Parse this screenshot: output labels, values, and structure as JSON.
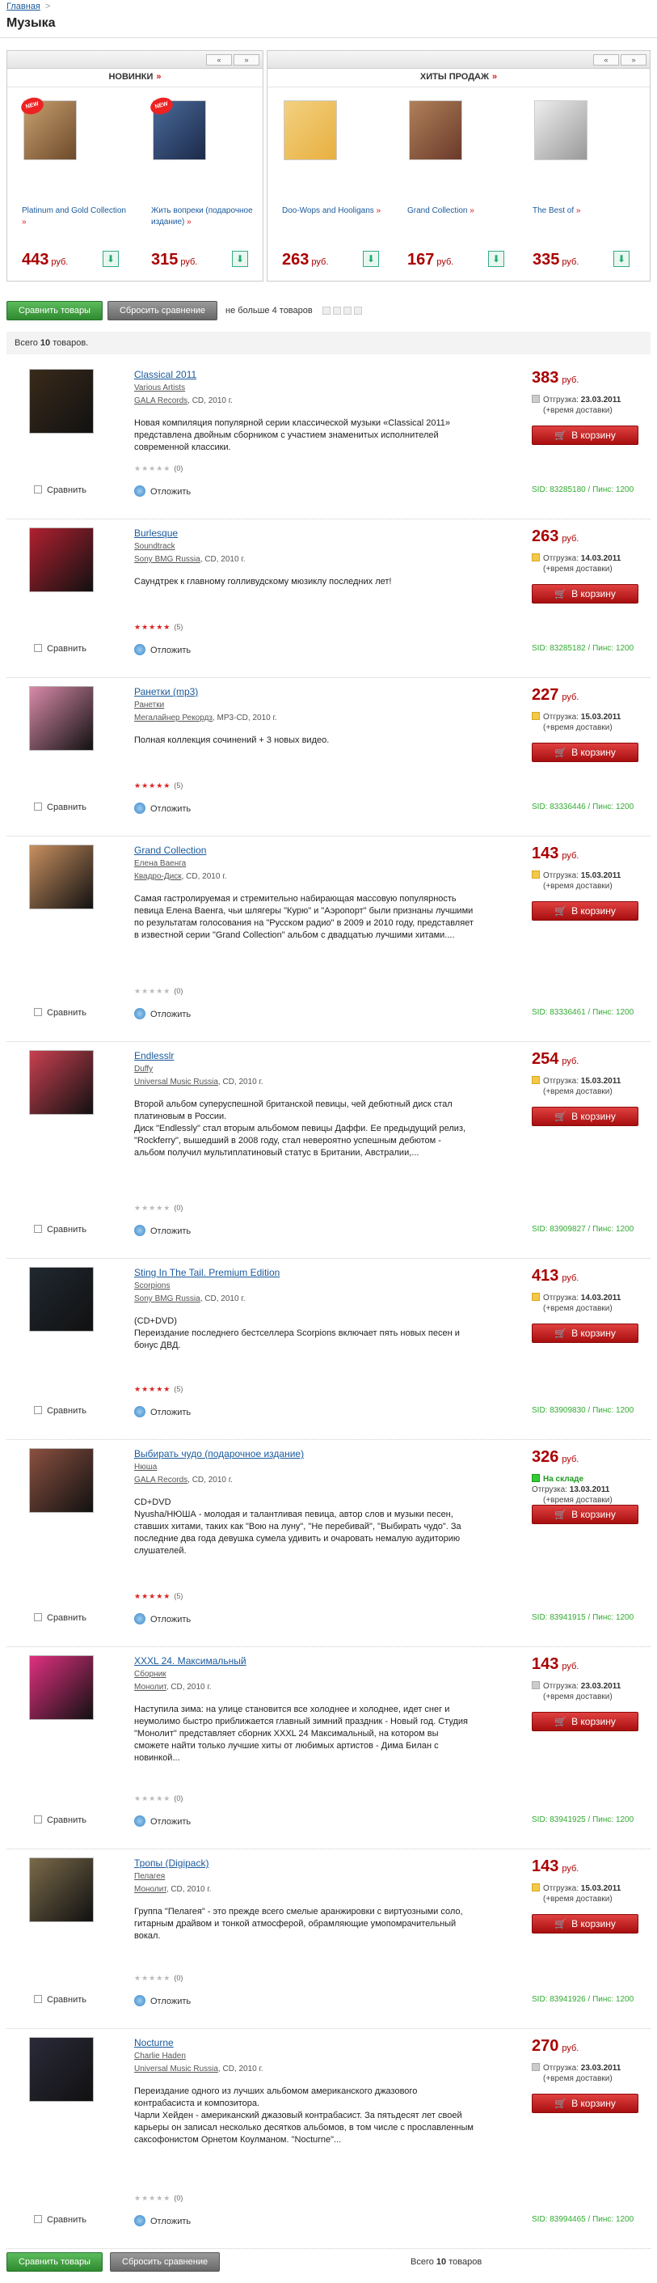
{
  "breadcrumb": {
    "home": "Главная",
    "sep": ">"
  },
  "title": "Музыка",
  "panels": {
    "new": {
      "title": "НОВИНКИ",
      "arrow": "»",
      "nav_prev": "«",
      "nav_next": "»",
      "badge": "NEW",
      "items": [
        {
          "name": "Platinum and Gold Collection",
          "more": "»",
          "price": "443",
          "rub": "руб.",
          "color": "#6d4a2a"
        },
        {
          "name": "Жить вопреки (подарочное издание)",
          "more": "»",
          "price": "315",
          "rub": "руб.",
          "color": "#1c2a4a"
        }
      ]
    },
    "hits": {
      "title": "ХИТЫ ПРОДАЖ",
      "arrow": "»",
      "nav_prev": "«",
      "nav_next": "»",
      "items": [
        {
          "name": "Doo-Wops and Hooligans",
          "more": "»",
          "price": "263",
          "rub": "руб.",
          "color": "#e8b040"
        },
        {
          "name": "Grand Collection",
          "more": "»",
          "price": "167",
          "rub": "руб.",
          "color": "#6a3a2a"
        },
        {
          "name": "The Best of",
          "more": "»",
          "price": "335",
          "rub": "руб.",
          "color": "#cfcfcf"
        }
      ]
    }
  },
  "compare": {
    "btn": "Сравнить товары",
    "reset": "Сбросить сравнение",
    "note": "не больше 4 товаров"
  },
  "total": {
    "prefix": "Всего",
    "count": "10",
    "suffix": "товаров."
  },
  "labels": {
    "compare": "Сравнить",
    "later": "Отложить",
    "cart": "В корзину",
    "rub": "руб.",
    "ship": "Отгрузка:",
    "delivery": "(+время доставки)",
    "instock": "На складе",
    "sid_prefix": "SID:",
    "pins_prefix": "Пинс:"
  },
  "items": [
    {
      "title": "Classical 2011",
      "artist": "Various Artists",
      "label": "GALA Records",
      "meta": ", CD, 2010 г.",
      "desc": "Новая компиляция популярной серии классической музыки «Classical 2011» представлена двойным сборником с участием знаменитых исполнителей современной классики.",
      "stars": "★★★★★",
      "rating": "(0)",
      "price": "383",
      "date": "23.03.2011",
      "sid": "83285180",
      "pins": "1200",
      "color": "#3a2a1a",
      "shipcolor": "grey"
    },
    {
      "title": "Burlesque",
      "artist": "Soundtrack",
      "label": "Sony BMG Russia",
      "meta": ", CD, 2010 г.",
      "desc": "Саундтрек к главному голливудскому мюзиклу последних лет!",
      "stars": "★★★★★",
      "rating": "(5)",
      "price": "263",
      "date": "14.03.2011",
      "sid": "83285182",
      "pins": "1200",
      "color": "#b02030",
      "shipcolor": ""
    },
    {
      "title": "Ранетки (mp3)",
      "artist": "Ранетки",
      "label": "Мегалайнер Рекордз",
      "meta": ", MP3-CD, 2010 г.",
      "desc": "Полная коллекция сочинений + 3 новых видео.",
      "stars": "★★★★★",
      "rating": "(5)",
      "price": "227",
      "date": "15.03.2011",
      "sid": "83336446",
      "pins": "1200",
      "color": "#d88aa8",
      "shipcolor": ""
    },
    {
      "title": "Grand Collection",
      "artist": "Елена Ваенга",
      "label": "Квадро-Диск",
      "meta": ", CD, 2010 г.",
      "desc": "Самая гастролируемая и стремительно набирающая массовую популярность певица Елена Ваенга, чьи шлягеры \"Курю\" и \"Аэропорт\" были признаны лучшими по результатам голосования на \"Русском радио\" в 2009 и 2010 году, представляет в известной серии \"Grand Collection\" альбом с двадцатью лучшими хитами....",
      "stars": "★★★★★",
      "rating": "(0)",
      "price": "143",
      "date": "15.03.2011",
      "sid": "83336461",
      "pins": "1200",
      "color": "#c89060",
      "shipcolor": ""
    },
    {
      "title": "Endlesslr",
      "artist": "Duffy",
      "label": "Universal Music Russia",
      "meta": ", CD, 2010 г.",
      "desc": "Второй альбом суперуспешной британской певицы, чей дебютный диск стал платиновым в России.\nДиск \"Endlessly\" стал вторым альбомом певицы Даффи. Ее предыдущий релиз, \"Rockferry\", вышедший в 2008 году, стал невероятно успешным дебютом - альбом получил мультиплатиновый статус в Британии, Австралии,...",
      "stars": "★★★★★",
      "rating": "(0)",
      "price": "254",
      "date": "15.03.2011",
      "sid": "83909827",
      "pins": "1200",
      "color": "#c84050",
      "shipcolor": ""
    },
    {
      "title": "Sting In The Tail. Premium Edition",
      "artist": "Scorpions",
      "label": "Sony BMG Russia",
      "meta": ", CD, 2010 г.",
      "desc": "(CD+DVD)\nПереиздание последнего бестселлера Scorpions включает пять новых песен и бонус ДВД.",
      "stars": "★★★★★",
      "rating": "(5)",
      "price": "413",
      "date": "14.03.2011",
      "sid": "83909830",
      "pins": "1200",
      "color": "#202830",
      "shipcolor": ""
    },
    {
      "title": "Выбирать чудо (подарочное издание)",
      "artist": "Нюша",
      "label": "GALA Records",
      "meta": ", CD, 2010 г.",
      "desc": "CD+DVD\nNyusha/НЮША - молодая и талантливая певица, автор слов и музыки песен, ставших хитами, таких как \"Вою на луну\", \"Не перебивай\", \"Выбирать чудо\". За последние два года девушка сумела удивить и очаровать немалую аудиторию слушателей.",
      "stars": "★★★★★",
      "rating": "(5)",
      "price": "326",
      "date": "13.03.2011",
      "sid": "83941915",
      "pins": "1200",
      "color": "#8a5040",
      "shipcolor": "green",
      "instock": true
    },
    {
      "title": "XXXL 24. Максимальный",
      "artist": "Сборник",
      "label": "Монолит",
      "meta": ", CD, 2010 г.",
      "desc": "Наступила зима: на улице становится все холоднее и холоднее, идет снег и неумолимо быстро приближается главный зимний праздник - Новый год. Студия \"Монолит\" представляет сборник XXXL 24 Максимальный, на котором вы сможете найти только лучшие хиты от любимых артистов - Дима Билан с новинкой...",
      "stars": "★★★★★",
      "rating": "(0)",
      "price": "143",
      "date": "23.03.2011",
      "sid": "83941925",
      "pins": "1200",
      "color": "#e03080",
      "shipcolor": "grey"
    },
    {
      "title": "Тропы (Digipack)",
      "artist": "Пелагея",
      "label": "Монолит",
      "meta": ", CD, 2010 г.",
      "desc": "Группа \"Пелагея\" - это прежде всего смелые аранжировки с виртуозными соло, гитарным драйвом и тонкой атмосферой, обрамляющие умопомрачительный вокал.",
      "stars": "★★★★★",
      "rating": "(0)",
      "price": "143",
      "date": "15.03.2011",
      "sid": "83941926",
      "pins": "1200",
      "color": "#7a6a4a",
      "shipcolor": ""
    },
    {
      "title": "Nocturne",
      "artist": "Charlie Haden",
      "label": "Universal Music Russia",
      "meta": ", CD, 2010 г.",
      "desc": "Переиздание одного из лучших альбомом американского джазового контрабасиста и композитора.\nЧарли Хейден - американский джазовый контрабасист. За пятьдесят лет своей карьеры он записал несколько десятков альбомов, в том числе с прославленным саксофонистом Орнетом Коулманом. \"Nocturne\"...",
      "stars": "★★★★★",
      "rating": "(0)",
      "price": "270",
      "date": "23.03.2011",
      "sid": "83994465",
      "pins": "1200",
      "color": "#2a2a3a",
      "shipcolor": "grey"
    }
  ],
  "bottom": {
    "btn": "Сравнить товары",
    "reset": "Сбросить сравнение",
    "total_prefix": "Всего",
    "total_count": "10",
    "total_suffix": "товаров"
  }
}
